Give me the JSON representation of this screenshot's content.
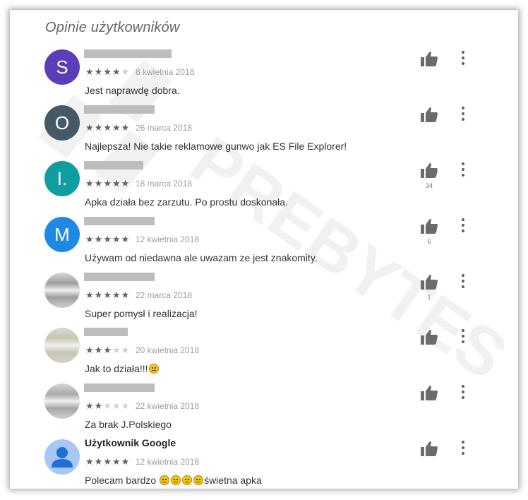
{
  "section_title": "Opinie użytkowników",
  "colors": {
    "star_on": "#616161",
    "star_off": "#d0d0d0",
    "icon": "#6b6b6b"
  },
  "reviews": [
    {
      "avatar_type": "letter",
      "initial": "S",
      "avatar_color": "#5b3db8",
      "name": "",
      "rating": 4,
      "date": "8 kwietnia 2018",
      "text": "Jest naprawdę dobra.",
      "likes": ""
    },
    {
      "avatar_type": "letter",
      "initial": "O",
      "avatar_color": "#455a64",
      "name": "",
      "rating": 5,
      "date": "26 marca 2018",
      "text": "Najlepsza! Nie takie reklamowe gunwo jak ES File Explorer!",
      "likes": ""
    },
    {
      "avatar_type": "letter",
      "initial": "I.",
      "avatar_color": "#0f9d9f",
      "name": "",
      "rating": 5,
      "date": "18 marca 2018",
      "text": "Apka działa bez zarzutu. Po prostu doskonała.",
      "likes": "34"
    },
    {
      "avatar_type": "letter",
      "initial": "M",
      "avatar_color": "#1e88e5",
      "name": "",
      "rating": 5,
      "date": "12 kwietnia 2018",
      "text": "Używam od niedawna ale uwazam ze jest znakomity.",
      "likes": "6"
    },
    {
      "avatar_type": "photo",
      "initial": "",
      "avatar_color": "#9e9e9e",
      "name": "",
      "rating": 5,
      "date": "22 marca 2018",
      "text": "Super pomysł i realizacja!",
      "likes": "1"
    },
    {
      "avatar_type": "photo",
      "initial": "",
      "avatar_color": "#c9c6b0",
      "name": "",
      "rating": 3,
      "date": "20 kwietnia 2018",
      "text": "Jak to działa!!!",
      "emoji_count": 1,
      "text_after": "",
      "likes": ""
    },
    {
      "avatar_type": "photo",
      "initial": "",
      "avatar_color": "#a8a8a8",
      "name": "",
      "rating": 2,
      "date": "22 kwietnia 2018",
      "text": "Za brak J.Polskiego",
      "likes": ""
    },
    {
      "avatar_type": "google",
      "initial": "",
      "avatar_color": "#a7c7f5",
      "name": "Użytkownik Google",
      "rating": 5,
      "date": "12 kwietnia 2018",
      "text": "Polecam bardzo ",
      "emoji_count": 4,
      "text_after": "świetna apka",
      "likes": ""
    }
  ]
}
